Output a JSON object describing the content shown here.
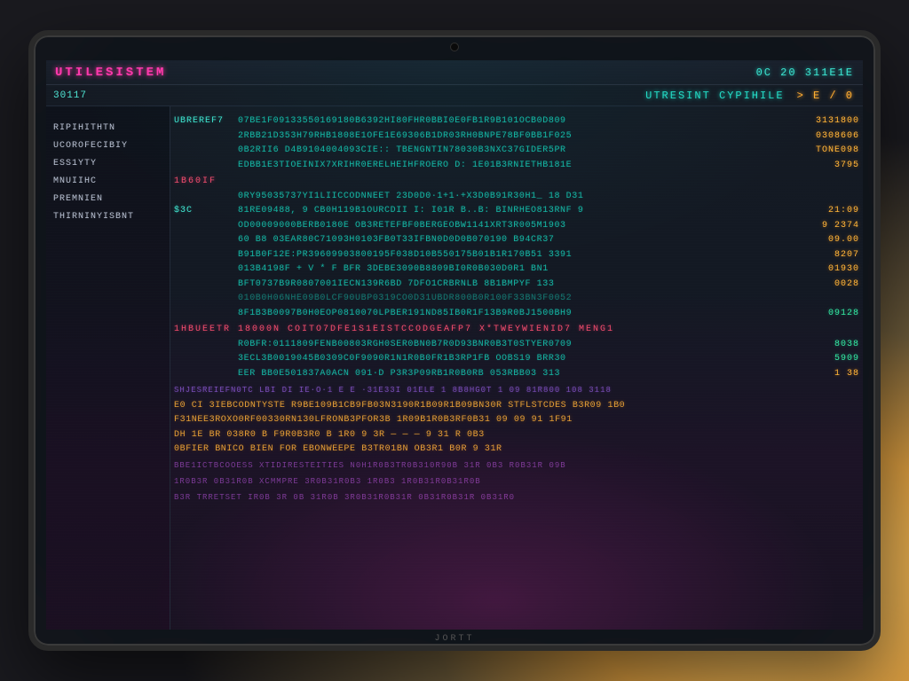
{
  "titlebar": {
    "title_left": "UTILESISTEM",
    "title_right": "0C 20  311E1E"
  },
  "subbar": {
    "prompt": "30117",
    "status_text": "UTRESINT CYPIHILE",
    "status_cursor": ">  E / 0"
  },
  "sidebar": {
    "items": [
      "RIPIHITHTN",
      "UCOROFECIBIY",
      "ESS1YTY",
      "MNUIIHC",
      "PREMNIEN",
      "THIRNINYISBNT"
    ]
  },
  "main": {
    "rows": [
      {
        "label": "UBREREF7",
        "hex": "07BE1F09133550169180B6392HI80FHR0BBI0E0FB1R9B101OCB0D809",
        "val": "3131800"
      },
      {
        "label": "",
        "hex": "2RBB21D353H79RHB1808E1OFE1E69306B1DR03RH0BNPE78BF0BB1F025",
        "val": "0308606"
      },
      {
        "label": "",
        "hex": "0B2RII6 D4B9104004093CIE:: TBENGNTIN78030B3NXC37GIDER5PR",
        "val": "TONE098"
      },
      {
        "label": "",
        "hex": "EDBB1E3TIOEINIX7XRIHR0ERELHEIHFROERO D: 1E01B3RNIETHB181E",
        "val": "3795"
      },
      {
        "label": " 1B60IF",
        "hex": "",
        "val": "",
        "sect": true
      },
      {
        "label": "",
        "hex": "0RY95035737YI1LIICCODNNEET  23D0D0·1+1·+X3D0B91R30H1_  18 D31",
        "val": ""
      },
      {
        "label": "$3C",
        "hex": "81RE09488, 9 CB0H119B1OURCDII I: I01R B..B: BINRHEO813RNF 9",
        "val": "21:09"
      },
      {
        "label": "",
        "hex": "OD00009000BERB0180E OB3RETEFBF0BERGEOBW1141XRT3R005M1903",
        "val": "9  2374"
      },
      {
        "label": "",
        "hex": "60 B8 03EAR80C71093H0103FB0T33IFBN0D0D0B070190 B94CR37",
        "val": "09.00"
      },
      {
        "label": "",
        "hex": "B91B0F12E:PR39609903800195F038D10B550175B01B1R170B51 3391",
        "val": "8207"
      },
      {
        "label": "",
        "hex": "013B4198F  + V  * F  BFR 3DEBE3090B8809BI0R0B030D0R1 BN1",
        "val": "01930"
      },
      {
        "label": "",
        "hex": "BFT0737B9R0807001IECN139R6BD 7DFO1CRBRNLB 8B1BMPYF 133",
        "val": "0028"
      },
      {
        "label": "",
        "hex": "010B0H06NHE09B0LCF90UBP0319CO0D31UBDR800B0R100F33BN3F0052",
        "val": "",
        "dim": true
      },
      {
        "label": "",
        "hex": "8F1B3B0097B0H0EOP0810070LPBER191ND85IB0R1F13B9R0BJ1500BH9",
        "val": "09128",
        "valg": true
      },
      {
        "label": "1HBUEETR",
        "hex": "18000N  COITO7DFE1S1EISTCCODGEAFP7  X*TWEYWIENID7   MENG1",
        "val": "",
        "sect": true
      },
      {
        "label": "",
        "hex": "R0BFR:0111809FENB00803RGH0SER0BN0B7R0D93BNR0B3T0STYER0709",
        "val": "8038",
        "valg": true
      },
      {
        "label": "",
        "hex": "3ECL3B0019045B0309C0F9090R1N1R0B0FR1B3RP1FB  OOBS19 BRR30",
        "val": "5909",
        "valg": true
      },
      {
        "label": "",
        "hex": "EER BB0E501837A0ACN 091·D  P3R3P09RB1R0B0RB 053RBB03 313",
        "val": "1 38"
      }
    ],
    "band": "SHJESREIEFN0TC  LBI DI IE·O·1 E E  ·31E33I  01ELE 1 8B8HG0T  1  09  81R800      108  3118",
    "lower": [
      "E0 CI  3IEBCODNTYSTE  R9BE109B1CB9FB03N3190R1B09R1B09BN30R  STFLSTCDES  B3R09 1B0",
      "F31NEE3ROXO0RF00330RN130LFRONB3PFOR3B  1R09B1R0B3RF0B31 09   09   91   1F91",
      "DH 1E   BR 038R0 B F9R0B3R0 B  1R0 9 3R   —  —  —   9 31 R 0B3",
      "0BFIER  BNICO  BIEN  FOR  EBONWEEPE  B3TR01BN  OB3R1 B0R  9 31R"
    ],
    "glitch": [
      "BBE1ICTBCOOESS  XTIDIRESTEITIES  N0H1R0B3TR0B310R90B  31R 0B3   R0B31R 09B",
      "  1R0B3R 0B31R0B   XCMMPRE   3R0B31R0B3  1R0B3   1R0B31R0B31R0B",
      "B3R TRRETSET  IR0B 3R  0B  31R0B 3R0B31R0B31R 0B31R0B31R 0B31R0"
    ]
  },
  "brand": "JORTT"
}
